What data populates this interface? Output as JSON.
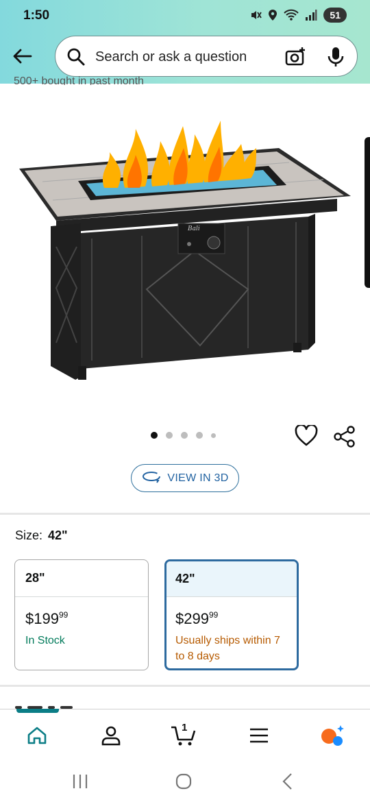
{
  "status_bar": {
    "time": "1:50",
    "battery": "51",
    "icons": [
      "mute-icon",
      "location-icon",
      "wifi-icon",
      "signal-icon"
    ]
  },
  "search": {
    "placeholder": "Search or ask a question"
  },
  "product": {
    "cut_text": "500+ bought in past month",
    "image_dots": {
      "count": 5,
      "active": 0
    },
    "view_3d_label": "VIEW IN 3D"
  },
  "size": {
    "label": "Size:",
    "selected": "42\"",
    "options": [
      {
        "name": "28\"",
        "price_dollars": "$199",
        "price_cents": "99",
        "availability": "In Stock",
        "availability_color": "#007a5a",
        "selected": false
      },
      {
        "name": "42\"",
        "price_dollars": "$299",
        "price_cents": "99",
        "availability": "Usually ships within 7 to 8 days",
        "availability_color": "#b65a00",
        "selected": true
      }
    ]
  },
  "bottom_nav": {
    "items": [
      "home-icon",
      "account-icon",
      "cart-icon",
      "menu-icon",
      "rufus-icon"
    ],
    "cart_count": "1",
    "accent": "#0b7d86"
  },
  "colors": {
    "header_start": "#83d9dd",
    "header_end": "#a6e6cf",
    "link_blue": "#2162a1",
    "selected_border": "#2d6a9f"
  }
}
